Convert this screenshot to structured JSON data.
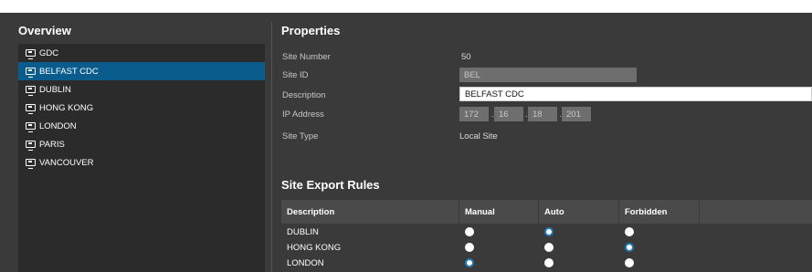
{
  "overview": {
    "title": "Overview",
    "sites": [
      {
        "label": "GDC",
        "selected": false,
        "icon": "site-icon"
      },
      {
        "label": "BELFAST CDC",
        "selected": true,
        "icon": "site-icon"
      },
      {
        "label": "DUBLIN",
        "selected": false,
        "icon": "site-icon"
      },
      {
        "label": "HONG KONG",
        "selected": false,
        "icon": "site-icon"
      },
      {
        "label": "LONDON",
        "selected": false,
        "icon": "site-icon"
      },
      {
        "label": "PARIS",
        "selected": false,
        "icon": "site-icon"
      },
      {
        "label": "VANCOUVER",
        "selected": false,
        "icon": "site-icon"
      }
    ]
  },
  "properties": {
    "title": "Properties",
    "site_number_label": "Site Number",
    "site_number_value": "50",
    "site_id_label": "Site ID",
    "site_id_value": "BEL",
    "description_label": "Description",
    "description_value": "BELFAST CDC",
    "ip_label": "IP Address",
    "ip_octets": [
      "172",
      "16",
      "18",
      "201"
    ],
    "site_type_label": "Site Type",
    "site_type_value": "Local Site"
  },
  "export_rules": {
    "title": "Site Export Rules",
    "columns": [
      "Description",
      "Manual",
      "Auto",
      "Forbidden"
    ],
    "rows": [
      {
        "name": "DUBLIN",
        "selected": "Auto"
      },
      {
        "name": "HONG KONG",
        "selected": "Forbidden"
      },
      {
        "name": "LONDON",
        "selected": "Manual"
      }
    ]
  },
  "colors": {
    "background": "#3a3a3a",
    "list_background": "#2b2b2b",
    "selected": "#0a5c8c",
    "radio_accent": "#1f7ab8"
  }
}
